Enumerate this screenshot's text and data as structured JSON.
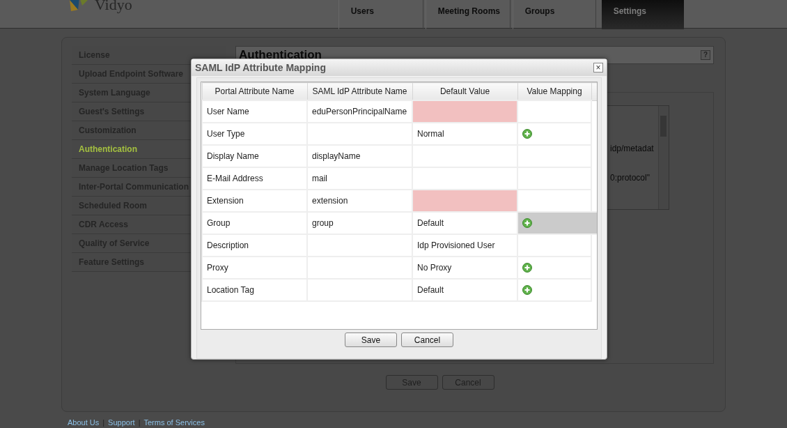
{
  "header": {
    "logo": "Vidyo",
    "tabs": [
      {
        "label": "Users",
        "selected": false
      },
      {
        "label": "Meeting Rooms",
        "selected": false
      },
      {
        "label": "Groups",
        "selected": false
      },
      {
        "label": "Settings",
        "selected": true
      }
    ]
  },
  "sidebar": {
    "items": [
      {
        "label": "License",
        "selected": false
      },
      {
        "label": "Upload Endpoint Software",
        "selected": false
      },
      {
        "label": "System Language",
        "selected": false
      },
      {
        "label": "Guest's Settings",
        "selected": false
      },
      {
        "label": "Customization",
        "selected": false
      },
      {
        "label": "Authentication",
        "selected": true
      },
      {
        "label": "Manage Location Tags",
        "selected": false
      },
      {
        "label": "Inter-Portal Communication",
        "selected": false
      },
      {
        "label": "Scheduled Room",
        "selected": false
      },
      {
        "label": "CDR Access",
        "selected": false
      },
      {
        "label": "Quality of Service",
        "selected": false
      },
      {
        "label": "Feature Settings",
        "selected": false
      }
    ]
  },
  "content": {
    "title": "Authentication",
    "help": "?",
    "metadata_lines": [
      "idp/metadat",
      "0:protocol\""
    ],
    "buttons": [
      "Save",
      "Cancel"
    ]
  },
  "footer": {
    "links": [
      "About Us",
      "Support",
      "Terms of Services"
    ],
    "separator": "|"
  },
  "dialog": {
    "title": "SAML IdP Attribute Mapping",
    "close": "×",
    "columns": [
      "Portal Attribute Name",
      "SAML IdP Attribute Name",
      "Default Value",
      "Value Mapping"
    ],
    "rows": [
      {
        "name": "User Name",
        "saml": "eduPersonPrincipalName",
        "default": "",
        "required": true,
        "mapping": false,
        "selected": false
      },
      {
        "name": "User Type",
        "saml": "",
        "default": "Normal",
        "required": false,
        "mapping": true,
        "selected": false
      },
      {
        "name": "Display Name",
        "saml": "displayName",
        "default": "",
        "required": false,
        "mapping": false,
        "selected": false
      },
      {
        "name": "E-Mail Address",
        "saml": "mail",
        "default": "",
        "required": false,
        "mapping": false,
        "selected": false
      },
      {
        "name": "Extension",
        "saml": "extension",
        "default": "",
        "required": true,
        "mapping": false,
        "selected": false
      },
      {
        "name": "Group",
        "saml": "group",
        "default": "Default",
        "required": false,
        "mapping": true,
        "selected": true
      },
      {
        "name": "Description",
        "saml": "",
        "default": "Idp Provisioned User",
        "required": false,
        "mapping": false,
        "selected": false
      },
      {
        "name": "Proxy",
        "saml": "",
        "default": "No Proxy",
        "required": false,
        "mapping": true,
        "selected": false
      },
      {
        "name": "Location Tag",
        "saml": "",
        "default": "Default",
        "required": false,
        "mapping": true,
        "selected": false
      }
    ],
    "buttons": [
      "Save",
      "Cancel"
    ]
  }
}
